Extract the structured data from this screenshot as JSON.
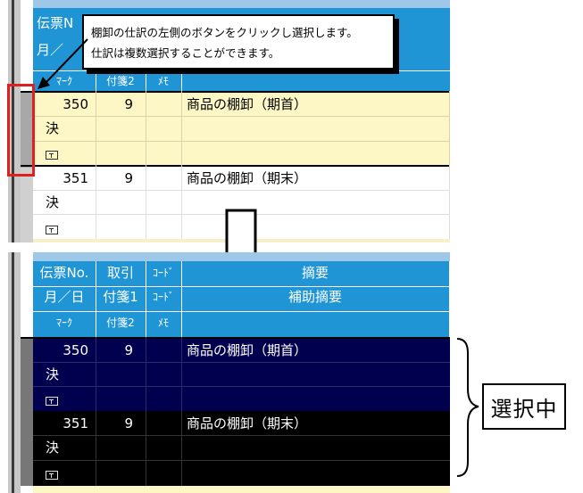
{
  "callout": {
    "line1": "棚卸の仕訳の左側のボタンをクリックし選択します。",
    "line2": "仕訳は複数選択することができます。"
  },
  "header": {
    "row1": [
      "伝票No.",
      "取引",
      "ｺｰﾄﾞ",
      "摘要"
    ],
    "row2": [
      "月／日",
      "付箋1",
      "ｺｰﾄﾞ",
      "補助摘要"
    ],
    "row3": [
      "ﾏｰｸ",
      "付箋2",
      "ﾒﾓ"
    ]
  },
  "top_header_partial": {
    "row1": "伝票N",
    "row2": "月／",
    "row3_a": "ﾏｰｸ",
    "row3_b": "付箋2",
    "row3_c": "ﾒﾓ"
  },
  "entries": [
    {
      "no": "350",
      "tag": "9",
      "summary": "商品の棚卸（期首）",
      "mark": "決"
    },
    {
      "no": "351",
      "tag": "9",
      "summary": "商品の棚卸（期末）",
      "mark": "決"
    }
  ],
  "selection_label": "選択中",
  "colors": {
    "header_blue": "#1f95d6",
    "highlight_yellow": "#fdf7c6",
    "selected_navy": "#00004f",
    "selected_black": "#000000",
    "red_box": "#e0201e"
  }
}
